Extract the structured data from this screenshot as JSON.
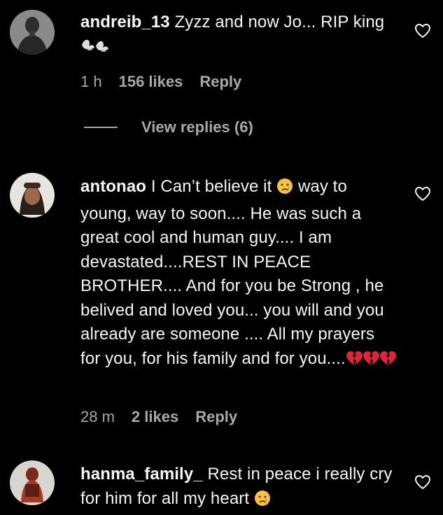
{
  "comments": [
    {
      "username": "andreib_13",
      "text": "Zyzz and now Jo... RIP king",
      "emoji": "🕊🕊",
      "time": "1 h",
      "likes": "156 likes",
      "reply_label": "Reply"
    },
    {
      "username": "antonao",
      "text_before_emoji": "I Can’t believe it",
      "emoji_1": "😢",
      "text_after_emoji": "way to young, way to soon.... He was such a great cool and human guy.... I am devastated....REST IN PEACE BROTHER.... And for you be Strong , he belived and loved you... you will and you already are someone .... All my prayers for you, for his family and for you....",
      "emoji_2": "💔💔💔",
      "time": "28 m",
      "likes": "2 likes",
      "reply_label": "Reply"
    },
    {
      "username": "hanma_family_",
      "text": "Rest in peace i really cry for him for all my heart",
      "emoji": "😢"
    }
  ],
  "view_replies": {
    "label": "View replies (6)"
  },
  "icons": {
    "heart": "heart-outline-icon",
    "dove": "dove-icon",
    "crying": "crying-face-icon",
    "broken_heart": "broken-heart-icon"
  },
  "colors": {
    "background": "#000000",
    "text": "#f5f5f5",
    "secondary": "#a8a8a8",
    "broken_heart": "#e0243a"
  }
}
